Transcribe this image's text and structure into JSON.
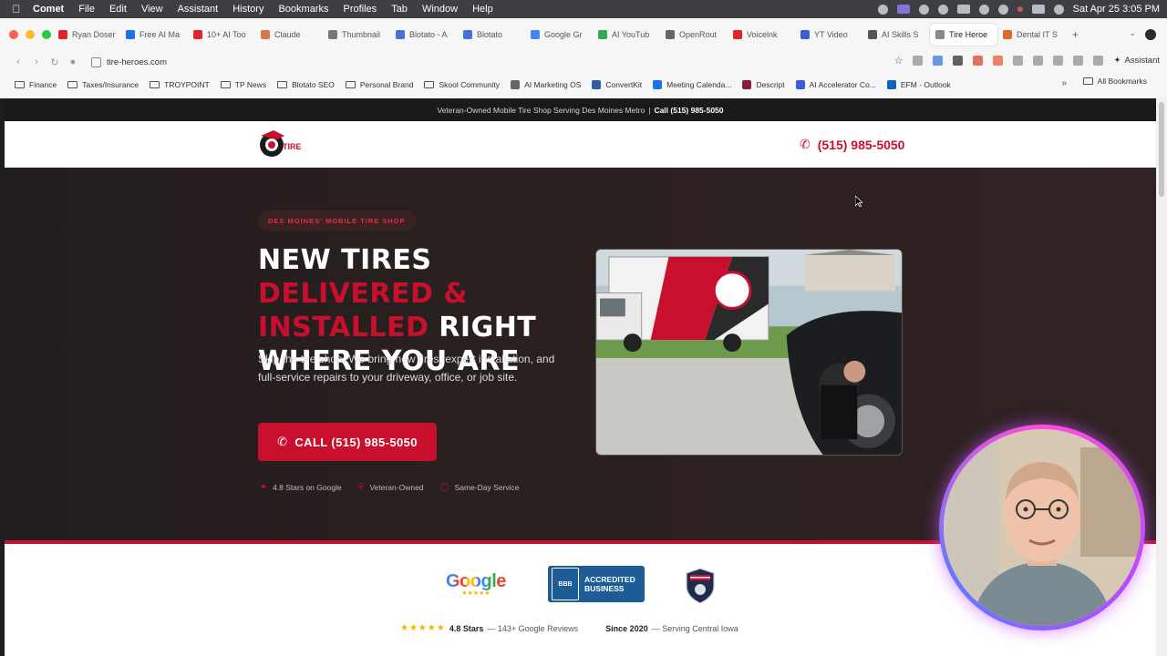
{
  "menubar": {
    "app": "Comet",
    "items": [
      "File",
      "Edit",
      "View",
      "Assistant",
      "History",
      "Bookmarks",
      "Profiles",
      "Tab",
      "Window",
      "Help"
    ],
    "clock": "Sat Apr 25  3:05 PM"
  },
  "tabs": [
    {
      "label": "Ryan Doser",
      "color": "#e0242c"
    },
    {
      "label": "Free AI Ma",
      "color": "#1a73e8"
    },
    {
      "label": "10+ AI Too",
      "color": "#e0242c"
    },
    {
      "label": "Claude",
      "color": "#d9774b"
    },
    {
      "label": "Thumbnail",
      "color": "#777777"
    },
    {
      "label": "Blotato - A",
      "color": "#4a6fd9"
    },
    {
      "label": "Blotato",
      "color": "#4a6fd9"
    },
    {
      "label": "Google Gr",
      "color": "#4285f4"
    },
    {
      "label": "AI YouTub",
      "color": "#34a853"
    },
    {
      "label": "OpenRout",
      "color": "#666666"
    },
    {
      "label": "Voicelnk",
      "color": "#e0242c"
    },
    {
      "label": "YT Video",
      "color": "#3b5bdb"
    },
    {
      "label": "AI Skills S",
      "color": "#555555"
    },
    {
      "label": "Tire Heroe",
      "color": "#888888"
    },
    {
      "label": "Dental IT S",
      "color": "#d96b2b"
    }
  ],
  "address": {
    "url": "tire-heroes.com",
    "assistant": "Assistant"
  },
  "bookmarks": [
    {
      "label": "Finance",
      "type": "folder"
    },
    {
      "label": "Taxes/Insurance",
      "type": "folder"
    },
    {
      "label": "TROYPOINT",
      "type": "folder"
    },
    {
      "label": "TP News",
      "type": "folder"
    },
    {
      "label": "Blotato SEO",
      "type": "folder"
    },
    {
      "label": "Personal Brand",
      "type": "folder"
    },
    {
      "label": "Skool Community",
      "type": "folder"
    },
    {
      "label": "AI Marketing OS",
      "type": "site",
      "color": "#666666"
    },
    {
      "label": "ConvertKit",
      "type": "site",
      "color": "#2b5fad"
    },
    {
      "label": "Meeting Calenda...",
      "type": "site",
      "color": "#1a73e8"
    },
    {
      "label": "Descript",
      "type": "site",
      "color": "#8a1d3c"
    },
    {
      "label": "AI Accelerator Co...",
      "type": "site",
      "color": "#3b5bdb"
    },
    {
      "label": "EFM - Outlook",
      "type": "site",
      "color": "#0a64c2"
    }
  ],
  "all_bookmarks": "All Bookmarks",
  "site": {
    "announce_text": "Veteran-Owned Mobile Tire Shop Serving Des Moines Metro",
    "announce_sep": "|",
    "announce_phone": "Call (515) 985-5050",
    "logo_text": "TIRE",
    "header_phone": "(515) 985-5050",
    "hero_tag": "DES MOINES' MOBILE TIRE SHOP",
    "hero_title_1": "NEW TIRES ",
    "hero_title_red": "DELIVERED & INSTALLED",
    "hero_title_2": " RIGHT WHERE YOU ARE",
    "hero_sub": "Skip the tire shop. We bring new tires, expert installation, and full-service repairs to your driveway, office, or job site.",
    "cta_label": "CALL (515) 985-5050",
    "trust": [
      "4.8 Stars on Google",
      "Veteran-Owned",
      "Same-Day Service"
    ],
    "google_word": "Google",
    "google_stars": "★★★★★",
    "bbb_seal": "BBB",
    "bbb_text_1": "ACCREDITED",
    "bbb_text_2": "BUSINESS",
    "stats_stars": "★★★★★",
    "stats_rating": "4.8 Stars",
    "stats_reviews": "— 143+ Google Reviews",
    "stats_since": "Since 2020",
    "stats_area": "— Serving Central Iowa"
  },
  "colors": {
    "brand_red": "#c8102e",
    "hero_bg": "#231d1d",
    "bbb_blue": "#1d5c97",
    "star_gold": "#f4b400"
  }
}
